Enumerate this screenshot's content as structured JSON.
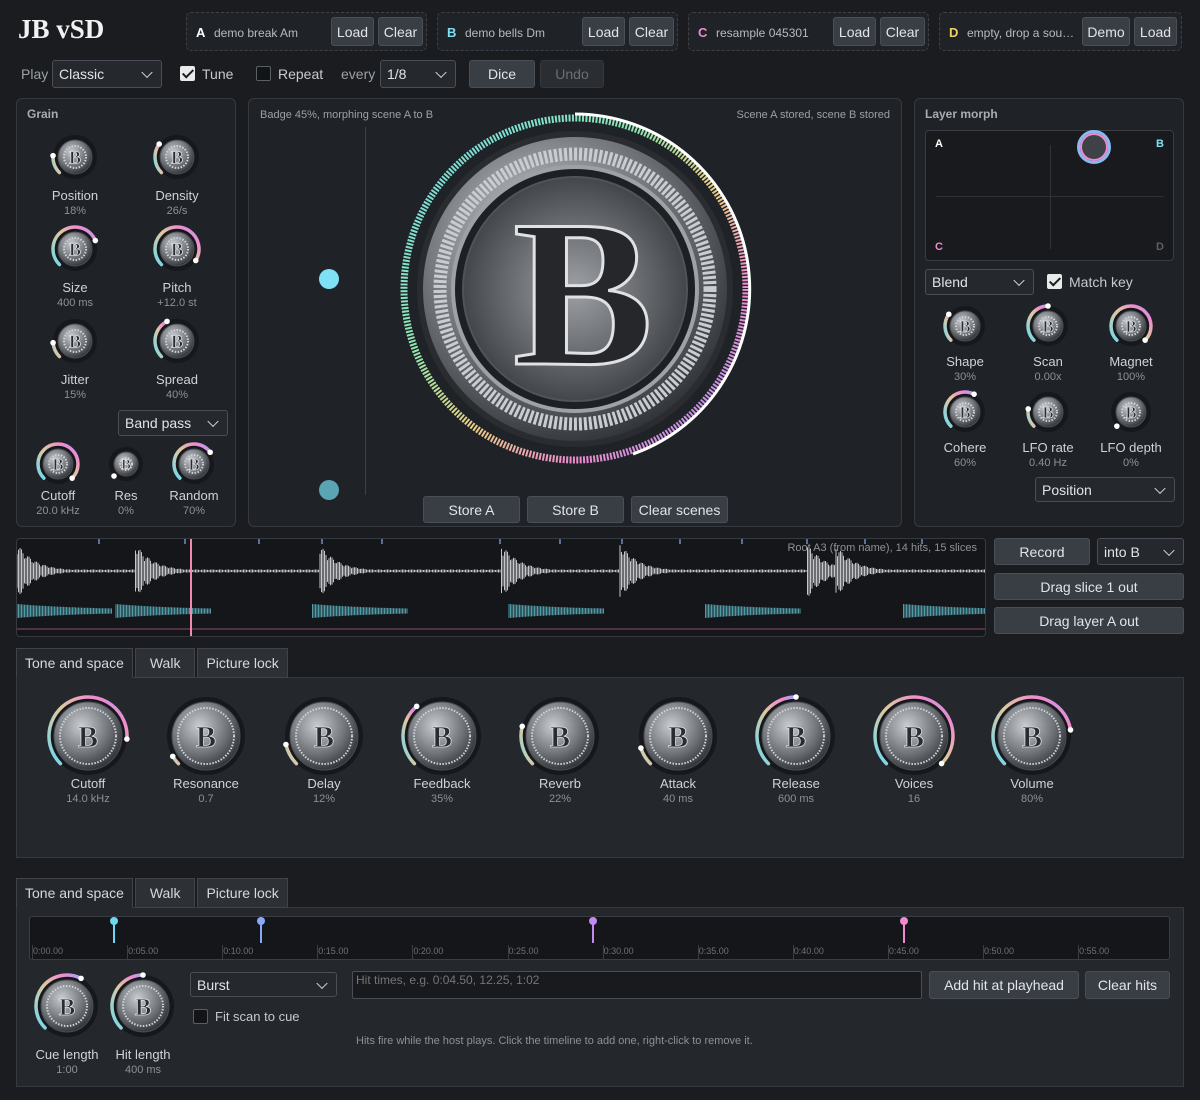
{
  "app": {
    "title": "JB vSD"
  },
  "slots": [
    {
      "letter": "A",
      "name": "demo break Am",
      "color": "#ffffff",
      "btn1": "Load",
      "btn2": "Clear"
    },
    {
      "letter": "B",
      "name": "demo bells Dm",
      "color": "#7fe0f5",
      "btn1": "Load",
      "btn2": "Clear"
    },
    {
      "letter": "C",
      "name": "resample 045301",
      "color": "#f08ad0",
      "btn1": "Load",
      "btn2": "Clear"
    },
    {
      "letter": "D",
      "name": "empty, drop a sou…",
      "color": "#f0d060",
      "btn1": "Demo",
      "btn2": "Load"
    }
  ],
  "toolbar": {
    "play_label": "Play",
    "play_mode": "Classic",
    "tune_label": "Tune",
    "repeat_label": "Repeat",
    "every_label": "every",
    "every_value": "1/8",
    "dice_label": "Dice",
    "undo_label": "Undo"
  },
  "grain": {
    "title": "Grain",
    "knobs": [
      {
        "label": "Position",
        "value": "18%",
        "level": 0.18
      },
      {
        "label": "Density",
        "value": "26/s",
        "level": 0.3
      },
      {
        "label": "Size",
        "value": "400 ms",
        "level": 0.75
      },
      {
        "label": "Pitch",
        "value": "+12.0 st",
        "level": 0.95
      },
      {
        "label": "Jitter",
        "value": "15%",
        "level": 0.15
      },
      {
        "label": "Spread",
        "value": "40%",
        "level": 0.4
      }
    ],
    "filter_type": "Band pass",
    "filter_knobs": [
      {
        "label": "Cutoff",
        "value": "20.0 kHz",
        "level": 1.0
      },
      {
        "label": "Res",
        "value": "0%",
        "level": 0.0
      },
      {
        "label": "Random",
        "value": "70%",
        "level": 0.7
      }
    ]
  },
  "center": {
    "status_left": "Badge 45%, morphing scene A to B",
    "status_right": "Scene A stored, scene B stored",
    "badge_letter": "B",
    "badge_level": 0.45,
    "store_a": "Store A",
    "store_b": "Store B",
    "clear_scenes": "Clear scenes"
  },
  "morph": {
    "title": "Layer morph",
    "corners": {
      "a": "A",
      "b": "B",
      "c": "C",
      "d": "D"
    },
    "mode": "Blend",
    "match_key_label": "Match key",
    "knobs": [
      {
        "label": "Shape",
        "value": "30%",
        "level": 0.3
      },
      {
        "label": "Scan",
        "value": "0.00x",
        "level": 0.5
      },
      {
        "label": "Magnet",
        "value": "100%",
        "level": 1.0
      },
      {
        "label": "Cohere",
        "value": "60%",
        "level": 0.6
      },
      {
        "label": "LFO rate",
        "value": "0.40 Hz",
        "level": 0.2
      },
      {
        "label": "LFO depth",
        "value": "0%",
        "level": 0.0
      }
    ],
    "target": "Position"
  },
  "wave": {
    "info": "Root A3 (from name), 14 hits, 15 slices",
    "playhead": 0.178
  },
  "side": {
    "record": "Record",
    "into": "into B",
    "drag_slice": "Drag slice 1 out",
    "drag_layer": "Drag layer A out"
  },
  "fx": {
    "tabs": [
      "Tone and space",
      "Walk",
      "Picture lock"
    ],
    "knobs": [
      {
        "label": "Cutoff",
        "value": "14.0 kHz",
        "level": 0.85
      },
      {
        "label": "Resonance",
        "value": "0.7",
        "level": 0.05
      },
      {
        "label": "Delay",
        "value": "12%",
        "level": 0.12
      },
      {
        "label": "Feedback",
        "value": "35%",
        "level": 0.35
      },
      {
        "label": "Reverb",
        "value": "22%",
        "level": 0.22
      },
      {
        "label": "Attack",
        "value": "40 ms",
        "level": 0.1
      },
      {
        "label": "Release",
        "value": "600 ms",
        "level": 0.5
      },
      {
        "label": "Voices",
        "value": "16",
        "level": 1.0
      },
      {
        "label": "Volume",
        "value": "80%",
        "level": 0.8
      }
    ]
  },
  "cue": {
    "tabs": [
      "Tone and space",
      "Walk",
      "Picture lock"
    ],
    "ticks": [
      "0:00.00",
      "0:05.00",
      "0:10.00",
      "0:15.00",
      "0:20.00",
      "0:25.00",
      "0:30.00",
      "0:35.00",
      "0:40.00",
      "0:45.00",
      "0:50.00",
      "0:55.00"
    ],
    "markers": [
      {
        "t": 0.0733,
        "color": "#6fd8f0"
      },
      {
        "t": 0.2025,
        "color": "#8aa8f8"
      },
      {
        "t": 0.4933,
        "color": "#c08af0"
      },
      {
        "t": 0.7658,
        "color": "#f08ad0"
      }
    ],
    "knobs": [
      {
        "label": "Cue length",
        "value": "1:00",
        "level": 0.6
      },
      {
        "label": "Hit length",
        "value": "400 ms",
        "level": 0.5
      }
    ],
    "mode": "Burst",
    "fit_label": "Fit scan to cue",
    "placeholder": "Hit times, e.g. 0:04.50, 12.25, 1:02",
    "add_hit": "Add hit at playhead",
    "clear_hits": "Clear hits",
    "hint": "Hits fire while the host plays. Click the timeline to add one, right-click to remove it."
  }
}
